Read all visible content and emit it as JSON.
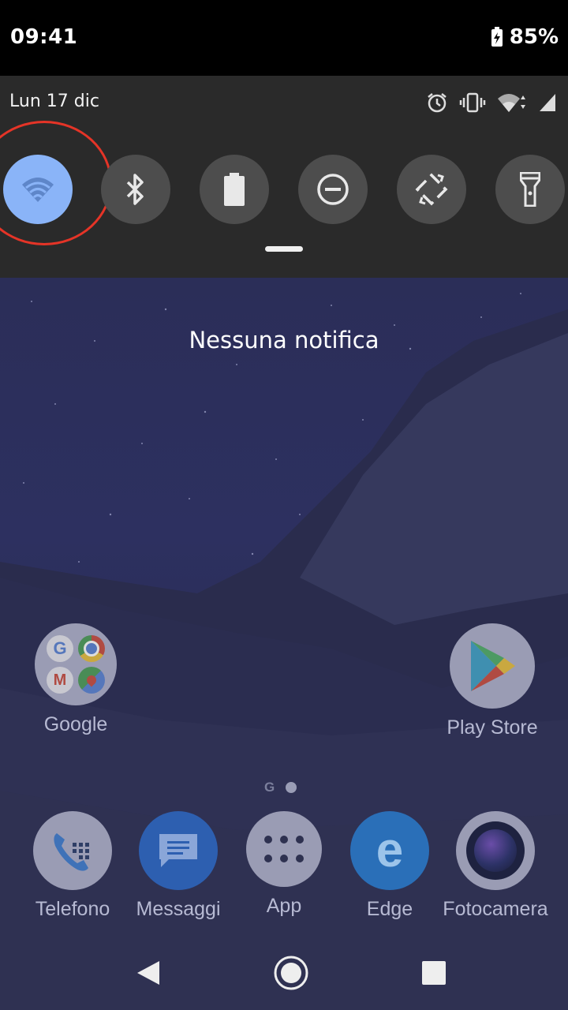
{
  "status_bar": {
    "time": "09:41",
    "battery_percent": "85%"
  },
  "quick_settings": {
    "date": "Lun 17 dic",
    "status_icons": [
      "alarm-icon",
      "vibrate-icon",
      "wifi-icon",
      "cell-signal-icon"
    ],
    "tiles": [
      {
        "name": "wifi",
        "icon": "wifi-icon",
        "active": true
      },
      {
        "name": "bluetooth",
        "icon": "bluetooth-icon",
        "active": false
      },
      {
        "name": "battery-saver",
        "icon": "battery-icon",
        "active": false
      },
      {
        "name": "do-not-disturb",
        "icon": "dnd-icon",
        "active": false
      },
      {
        "name": "auto-rotate",
        "icon": "rotate-icon",
        "active": false
      },
      {
        "name": "flashlight",
        "icon": "flashlight-icon",
        "active": false
      }
    ],
    "active_color": "#8ab4f8",
    "highlight_color": "#e53427"
  },
  "home": {
    "no_notifications": "Nessuna notifica",
    "folders": [
      {
        "label": "Google"
      }
    ],
    "apps_top": [
      {
        "label": "Play Store"
      }
    ],
    "dock": [
      {
        "label": "Telefono"
      },
      {
        "label": "Messaggi"
      },
      {
        "label": "App"
      },
      {
        "label": "Edge"
      },
      {
        "label": "Fotocamera"
      }
    ],
    "page_indicator": {
      "google_letter": "G"
    }
  },
  "navigation": [
    "back-icon",
    "home-icon",
    "recents-icon"
  ]
}
